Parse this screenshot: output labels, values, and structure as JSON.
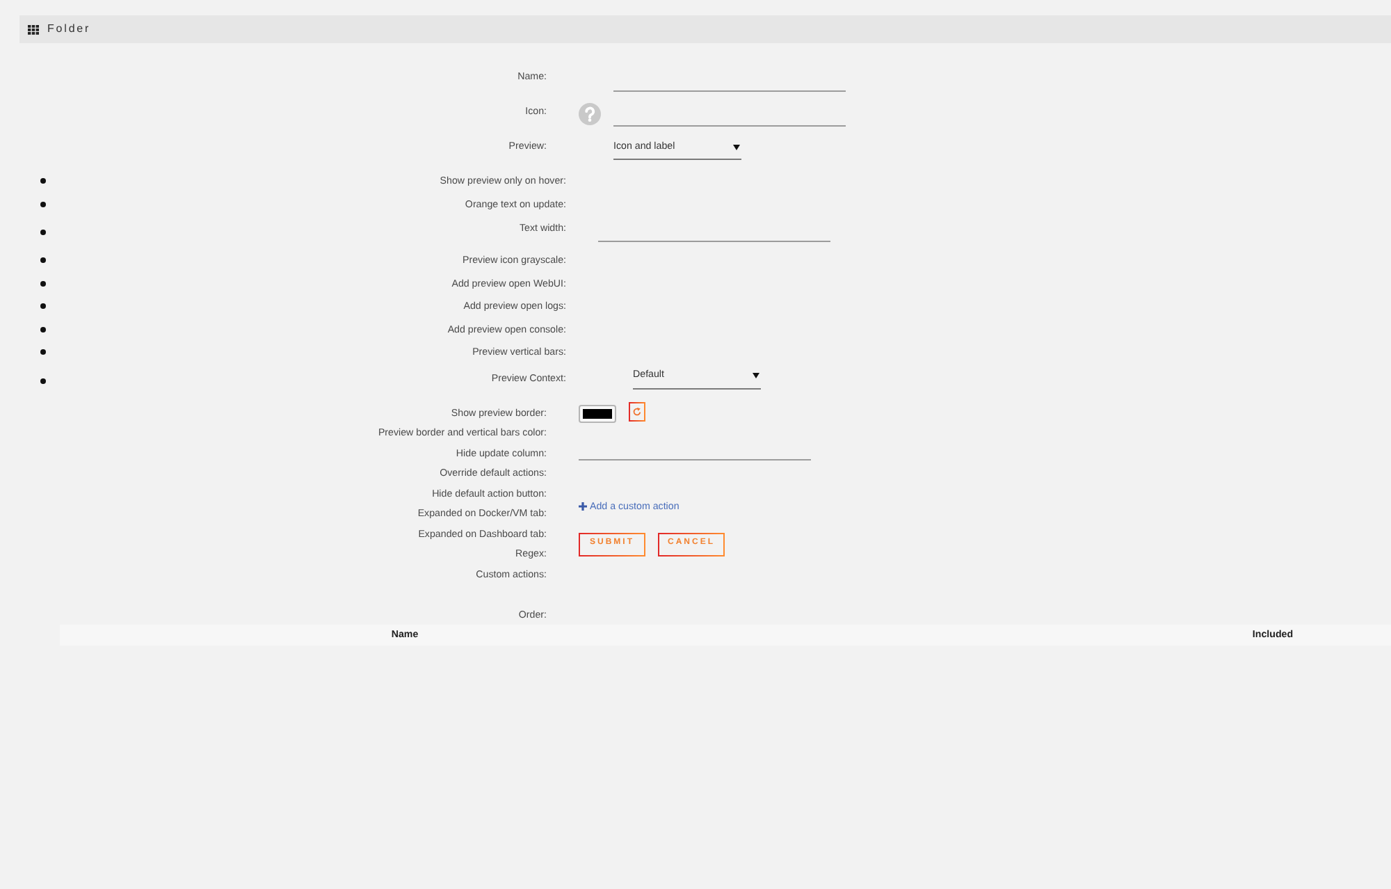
{
  "header": {
    "title": "Folder"
  },
  "fields": [
    {
      "kind": "text",
      "label": "Name:"
    },
    {
      "kind": "icon",
      "label": "Icon:"
    },
    {
      "kind": "select",
      "label": "Preview:",
      "value": "Icon and label"
    }
  ],
  "preview_options": [
    {
      "kind": "plain",
      "label": "Show preview only on hover:"
    },
    {
      "kind": "plain",
      "label": "Orange text on update:"
    },
    {
      "kind": "text",
      "label": "Text width:"
    },
    {
      "kind": "plain",
      "label": "Preview icon grayscale:"
    },
    {
      "kind": "plain",
      "label": "Add preview open WebUI:"
    },
    {
      "kind": "plain",
      "label": "Add preview open logs:"
    },
    {
      "kind": "plain",
      "label": "Add preview open console:"
    },
    {
      "kind": "plain",
      "label": "Preview vertical bars:"
    },
    {
      "kind": "select",
      "label": "Preview Context:",
      "value": "Default"
    }
  ],
  "settings_labels": [
    "Show preview border:",
    "Preview border and vertical bars color:",
    "Hide update column:",
    "Override default actions:",
    "Hide default action button:",
    "Expanded on Docker/VM tab:",
    "Expanded on Dashboard tab:",
    "Regex:",
    "Custom actions:"
  ],
  "settings_controls": [
    {
      "kind": "color",
      "color": "#000000"
    },
    {
      "kind": "text"
    },
    {
      "kind": "link",
      "label": "Add a custom action"
    },
    {
      "kind": "buttons",
      "buttons": [
        "SUBMIT",
        "CANCEL"
      ]
    }
  ],
  "order": {
    "label": "Order:"
  },
  "table": {
    "columns": [
      "Name",
      "Included"
    ]
  }
}
